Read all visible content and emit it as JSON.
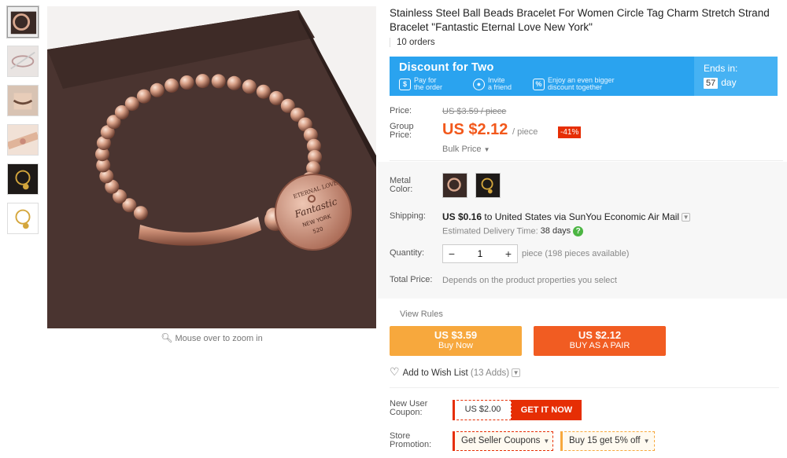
{
  "product": {
    "title": "Stainless Steel Ball Beads Bracelet For Women Circle Tag Charm Stretch Strand Bracelet \"Fantastic Eternal Love New York\"",
    "orders": "10 orders"
  },
  "gallery": {
    "zoom_hint": "Mouse over to zoom in",
    "thumbnail_count": 6,
    "active_index": 0,
    "tag_text_line1": "ETERNAL LOVE",
    "tag_text_line2": "Fantastic",
    "tag_text_line3": "NEW YORK",
    "tag_text_line4": "520"
  },
  "promo_banner": {
    "title": "Discount for Two",
    "step1": [
      "Pay for",
      "the order"
    ],
    "step2": [
      "Invite",
      "a friend"
    ],
    "step3": [
      "Enjoy an even bigger",
      "discount together"
    ],
    "ends_label": "Ends in:",
    "ends_value": "57",
    "ends_unit": "day",
    "color": "#2aa3ef"
  },
  "pricing": {
    "price_label": "Price:",
    "original_price": "US $3.59 / piece",
    "group_label_1": "Group",
    "group_label_2": "Price:",
    "group_price": "US $2.12",
    "per_unit": "/ piece",
    "discount": "-41%",
    "bulk_price": "Bulk Price",
    "accent_color": "#f2581b"
  },
  "options": {
    "metal_label_1": "Metal",
    "metal_label_2": "Color:",
    "swatches": [
      "rose-gold",
      "gold"
    ]
  },
  "shipping": {
    "label": "Shipping:",
    "cost": "US $0.16",
    "text": "to United States via SunYou Economic Air Mail",
    "delivery_label": "Estimated Delivery Time:",
    "delivery_value": "38 days"
  },
  "quantity": {
    "label": "Quantity:",
    "value": "1",
    "minus": "−",
    "plus": "+",
    "available": "piece (198 pieces available)"
  },
  "total": {
    "label": "Total Price:",
    "text": "Depends on the product properties you select"
  },
  "actions": {
    "view_rules": "View Rules",
    "buy_now_price": "US $3.59",
    "buy_now_label": "Buy Now",
    "buy_pair_price": "US $2.12",
    "buy_pair_label": "BUY AS A PAIR",
    "wish_label": "Add to Wish List",
    "wish_adds": "(13 Adds)"
  },
  "coupons": {
    "new_user_label_1": "New User",
    "new_user_label_2": "Coupon:",
    "coupon_amount": "US $2.00",
    "get_it_now": "GET IT NOW",
    "store_label_1": "Store",
    "store_label_2": "Promotion:",
    "seller_coupons": "Get Seller Coupons",
    "buy_more": "Buy 15 get 5% off"
  }
}
